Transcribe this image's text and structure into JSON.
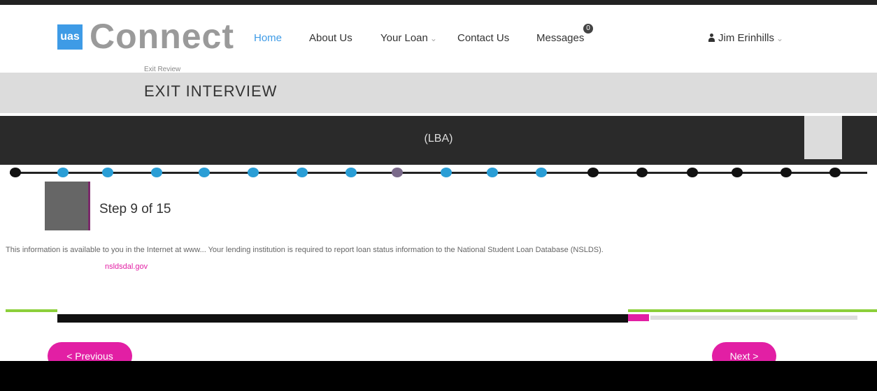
{
  "nav": {
    "logo_badge": "uas",
    "logo_text": "Connect",
    "items": [
      {
        "label": "Home",
        "active": true
      },
      {
        "label": "About Us"
      },
      {
        "label": "Your Loan"
      },
      {
        "label": "Contact Us"
      },
      {
        "label": "Messages"
      }
    ],
    "messages_count": "0",
    "user_name": "Jim Erinhills"
  },
  "breadcrumb": "Exit Review",
  "page_title": "EXIT INTERVIEW",
  "section": {
    "line2": "(LBA)"
  },
  "step": {
    "label": "Step 9 of 15"
  },
  "content": {
    "body_line1": "This information is available to you in the Internet at www... Your lending institution is required to report loan status information to the National Student Loan Database (NSLDS).",
    "link_text": "nsldsdal.gov"
  },
  "buttons": {
    "previous": "< Previous",
    "next": "Next >"
  },
  "colors": {
    "accent_blue": "#3e9be6",
    "accent_pink": "#e21fa4",
    "accent_green": "#8ccf3a"
  }
}
